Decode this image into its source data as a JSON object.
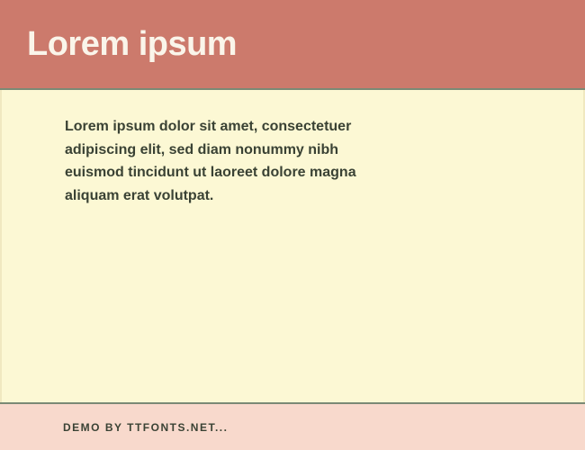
{
  "header": {
    "title": "Lorem ipsum"
  },
  "content": {
    "body": "Lorem ipsum dolor sit amet, consectetuer adipiscing elit, sed diam nonummy nibh euismod tincidunt ut laoreet dolore magna aliquam erat volutpat."
  },
  "footer": {
    "text": "DEMO BY TTFONTS.NET..."
  }
}
